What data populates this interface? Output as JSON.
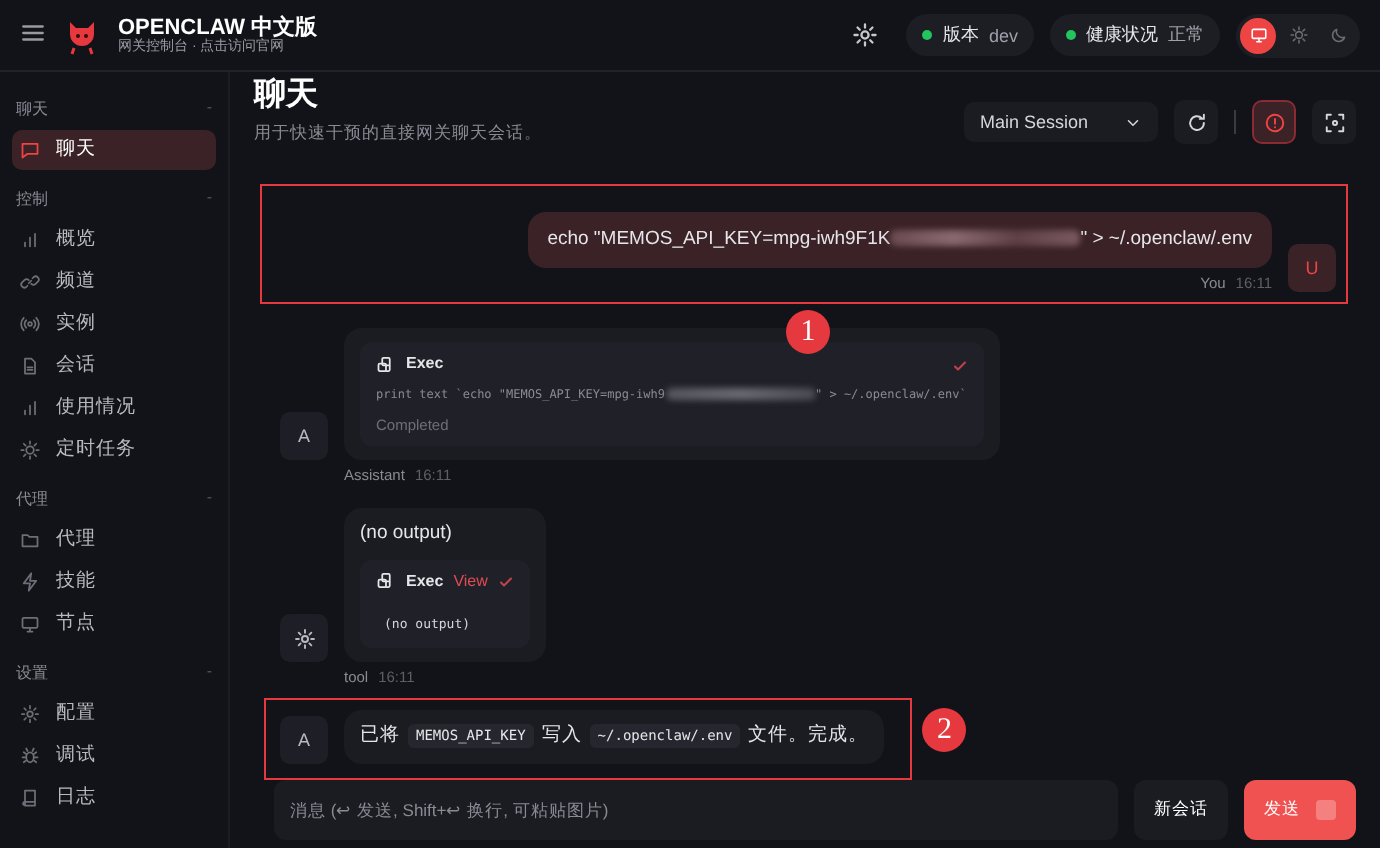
{
  "header": {
    "title": "OPENCLAW 中文版",
    "subtitle": "网关控制台 · 点击访问官网",
    "pills": [
      {
        "label": "版本",
        "value": "dev",
        "color": "#22c55e"
      },
      {
        "label": "健康状况",
        "value": "正常",
        "color": "#22c55e"
      }
    ],
    "theme_options": [
      {
        "selected": true
      },
      {
        "selected": false
      },
      {
        "selected": false
      }
    ]
  },
  "sidebar": {
    "groups": [
      {
        "title": "聊天",
        "toggle": "-",
        "items": [
          {
            "label": "聊天",
            "selected": true
          }
        ]
      },
      {
        "title": "控制",
        "toggle": "-",
        "items": [
          {
            "label": "概览",
            "selected": false
          },
          {
            "label": "频道",
            "selected": false
          },
          {
            "label": "实例",
            "selected": false
          },
          {
            "label": "会话",
            "selected": false
          },
          {
            "label": "使用情况",
            "selected": false
          },
          {
            "label": "定时任务",
            "selected": false
          }
        ]
      },
      {
        "title": "代理",
        "toggle": "-",
        "items": [
          {
            "label": "代理",
            "selected": false
          },
          {
            "label": "技能",
            "selected": false
          },
          {
            "label": "节点",
            "selected": false
          }
        ]
      },
      {
        "title": "设置",
        "toggle": "-",
        "items": [
          {
            "label": "配置",
            "selected": false
          },
          {
            "label": "调试",
            "selected": false
          },
          {
            "label": "日志",
            "selected": false
          }
        ]
      }
    ]
  },
  "page": {
    "title": "聊天",
    "subtitle": "用于快速干预的直接网关聊天会话。",
    "session": "Main Session"
  },
  "messages": [
    {
      "kind": "user",
      "avatar": "U",
      "sender": "You",
      "time": "16:11",
      "annotation": {
        "label": "1"
      },
      "parts": [
        {
          "kind": "text",
          "text": "echo \"MEMOS_API_KEY=mpg-iwh9F1K"
        },
        {
          "kind": "redacted"
        },
        {
          "kind": "text",
          "text": "\" > ~/.openclaw/.env"
        }
      ]
    },
    {
      "kind": "assistant",
      "avatar": "A",
      "sender": "Assistant",
      "time": "16:11",
      "tool": {
        "name": "Exec",
        "done": true,
        "command": [
          {
            "kind": "text",
            "text": "print text `echo \"MEMOS_API_KEY=mpg-iwh9"
          },
          {
            "kind": "redacted"
          },
          {
            "kind": "text",
            "text": "\" > ~/.openclaw/.env`"
          }
        ],
        "status": "Completed"
      }
    },
    {
      "kind": "tool",
      "sender": "tool",
      "time": "16:11",
      "text": "(no output)",
      "tool": {
        "name": "Exec",
        "link": "View",
        "done": true,
        "output": "(no output)"
      }
    },
    {
      "kind": "assistant",
      "avatar": "A",
      "annotation": {
        "label": "2"
      },
      "parts": [
        {
          "kind": "text",
          "text": "已将"
        },
        {
          "kind": "code",
          "text": "MEMOS_API_KEY"
        },
        {
          "kind": "text",
          "text": "写入"
        },
        {
          "kind": "code",
          "text": "~/.openclaw/.env"
        },
        {
          "kind": "text",
          "text": "文件。完成。"
        }
      ]
    }
  ],
  "composer": {
    "placeholder": "消息 (↩ 发送, Shift+↩ 换行, 可粘贴图片)",
    "new_session": "新会话",
    "send": "发送"
  }
}
